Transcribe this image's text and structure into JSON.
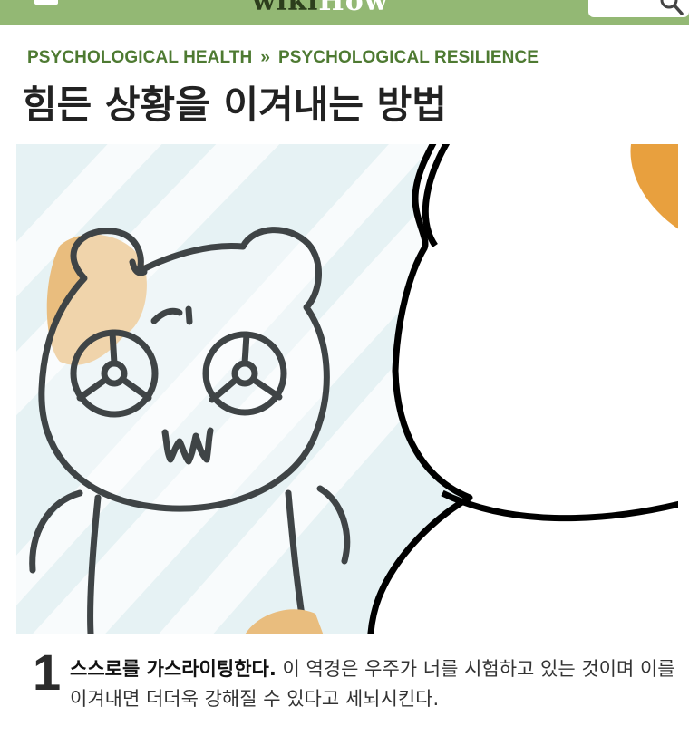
{
  "header": {
    "logo_bold": "wiki",
    "logo_light": "How",
    "brand_color": "#93b874"
  },
  "breadcrumb": {
    "items": [
      "PSYCHOLOGICAL HEALTH",
      "PSYCHOLOGICAL RESILIENCE"
    ],
    "separator": "»"
  },
  "article": {
    "title": "힘든 상황을 이겨내는 방법"
  },
  "step": {
    "number": "1",
    "bold": "스스로를 가스라이팅한다.",
    "text": " 이 역경은 우주가 너를 시험하고 있는 것이며 이를 이겨내면 더더욱 강해질 수 있다고 세뇌시킨다."
  },
  "icons": {
    "menu": "menu-icon",
    "search": "search-icon"
  }
}
